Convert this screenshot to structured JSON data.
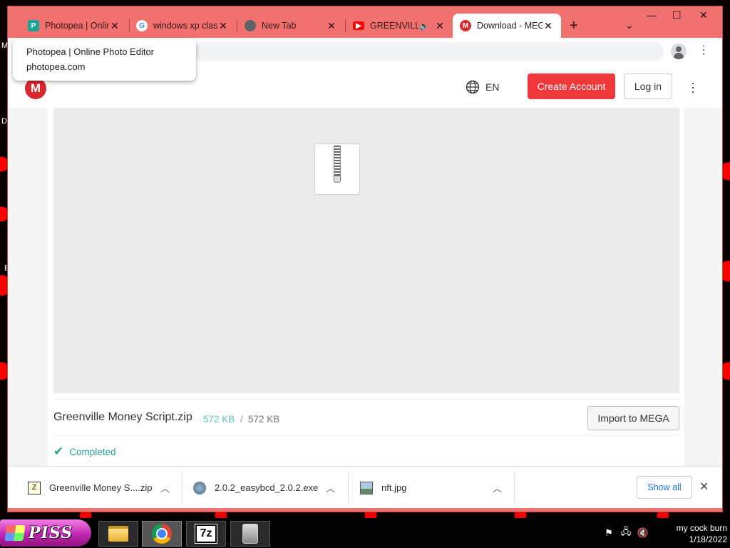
{
  "browser": {
    "tabs": [
      {
        "title": "Photopea | Online Photo Editor",
        "icon": "photopea-icon",
        "color": "#18a497"
      },
      {
        "title": "windows xp classic",
        "icon": "google-icon",
        "color": "#4285f4"
      },
      {
        "title": "New Tab",
        "icon": "chrome-icon",
        "color": "#5f6368"
      },
      {
        "title": "GREENVILLE",
        "icon": "youtube-icon",
        "color": "#ff0000",
        "audio": "speaker-icon"
      },
      {
        "title": "Download - MEGA",
        "icon": "mega-icon",
        "color": "#d9272e",
        "active": true
      }
    ],
    "new_tab_symbol": "+",
    "tab_search_symbol": "⌄",
    "window_controls": {
      "minimize": "—",
      "maximize": "☐",
      "close": "✕"
    },
    "frame_color": "#f07170"
  },
  "tooltip": {
    "title": "Photopea | Online Photo Editor",
    "url": "photopea.com"
  },
  "mega": {
    "logo": "M",
    "language": "EN",
    "create_account": "Create Account",
    "login": "Log in",
    "menu_icon": "kebab-icon",
    "file": {
      "name": "Greenville Money Script.zip",
      "size_done": "572 KB",
      "separator": "/",
      "size_total": "572 KB",
      "icon": "zip-file-icon"
    },
    "import_button": "Import to MEGA",
    "status": "Completed",
    "accent": "#f0373a",
    "status_color": "#25a38a"
  },
  "downloads": {
    "items": [
      {
        "name": "Greenville Money S....zip",
        "icon": "zip-icon"
      },
      {
        "name": "2.0.2_easybcd_2.0.2.exe",
        "icon": "exe-icon"
      },
      {
        "name": "nft.jpg",
        "icon": "image-icon"
      }
    ],
    "show_all": "Show all"
  },
  "desktop": {
    "left_edge_letters": [
      "M",
      "D",
      "E"
    ]
  },
  "taskbar": {
    "start_label": "PISS",
    "apps": [
      {
        "name": "file-explorer-icon"
      },
      {
        "name": "chrome-icon",
        "active": true
      },
      {
        "name": "7zip-icon",
        "label": "7z"
      },
      {
        "name": "installer-icon"
      }
    ],
    "tray_icons": [
      "flag-icon",
      "network-icon",
      "volume-muted-icon"
    ],
    "clock": {
      "user": "my cock burn",
      "date": "1/18/2022"
    }
  }
}
